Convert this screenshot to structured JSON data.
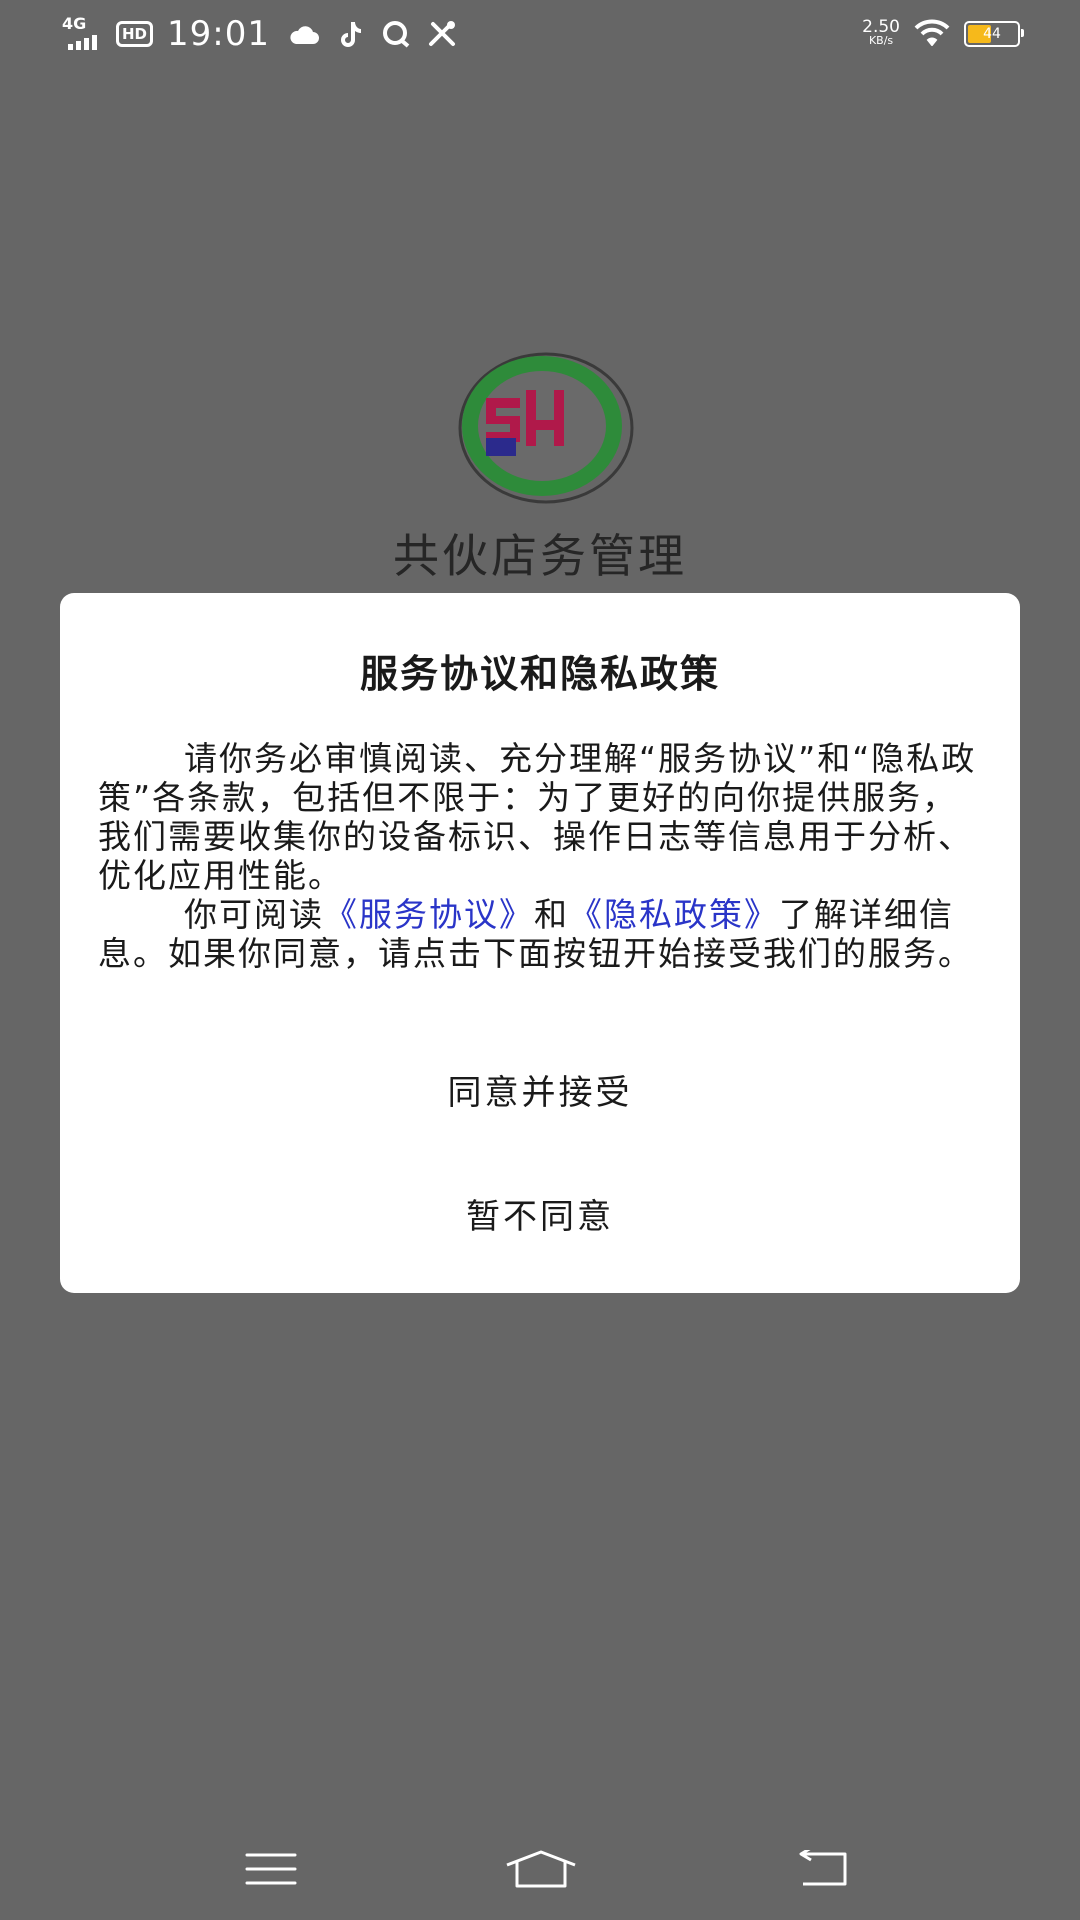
{
  "status_bar": {
    "network": "4G",
    "hd": "HD",
    "time": "19:01",
    "speed_value": "2.50",
    "speed_unit": "KB/s",
    "battery_level": "44",
    "icons": [
      "signal-icon",
      "cloud-icon",
      "tiktok-icon",
      "chat-icon",
      "tools-icon",
      "wifi-icon",
      "battery-icon"
    ]
  },
  "app": {
    "logo_letters": "SH",
    "name": "共伙店务管理"
  },
  "dialog": {
    "title": "服务协议和隐私政策",
    "paragraph1": "请你务必审慎阅读、充分理解“服务协议”和“隐私政策”各条款，包括但不限于：为了更好的向你提供服务，我们需要收集你的设备标识、操作日志等信息用于分析、优化应用性能。",
    "p2_prefix": "你可阅读",
    "service_link": "《服务协议》",
    "p2_and": "和",
    "privacy_link": "《隐私政策》",
    "p2_suffix": "了解详细信息。如果你同意，请点击下面按钮开始接受我们的服务。",
    "accept_label": "同意并接受",
    "decline_label": "暂不同意"
  },
  "colors": {
    "overlay_bg": "#666666",
    "link": "#2a35c8",
    "logo_green": "#2e8b3a",
    "logo_red": "#b0194a",
    "logo_blue": "#2b2a8c",
    "battery": "#f6b91b"
  },
  "nav_bar": {
    "icons": [
      "menu-icon",
      "home-icon",
      "back-icon"
    ]
  }
}
